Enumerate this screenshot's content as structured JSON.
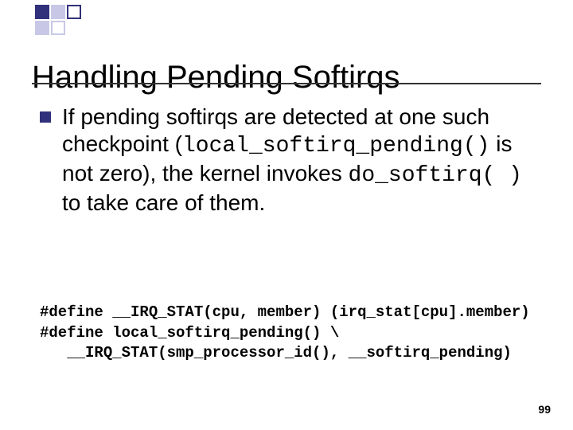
{
  "title": "Handling Pending Softirqs",
  "bullet": {
    "t1": "If pending softirqs are detected at one such checkpoint (",
    "c1": "local_softirq_pending()",
    "t2": " is not zero), the kernel invokes ",
    "c2": "do_softirq( )",
    "t3": " to take care of them."
  },
  "code": {
    "l1": "#define __IRQ_STAT(cpu, member) (irq_stat[cpu].member)",
    "l2": "#define local_softirq_pending() \\",
    "l3": "   __IRQ_STAT(smp_processor_id(), __softirq_pending)"
  },
  "page_number": "99"
}
